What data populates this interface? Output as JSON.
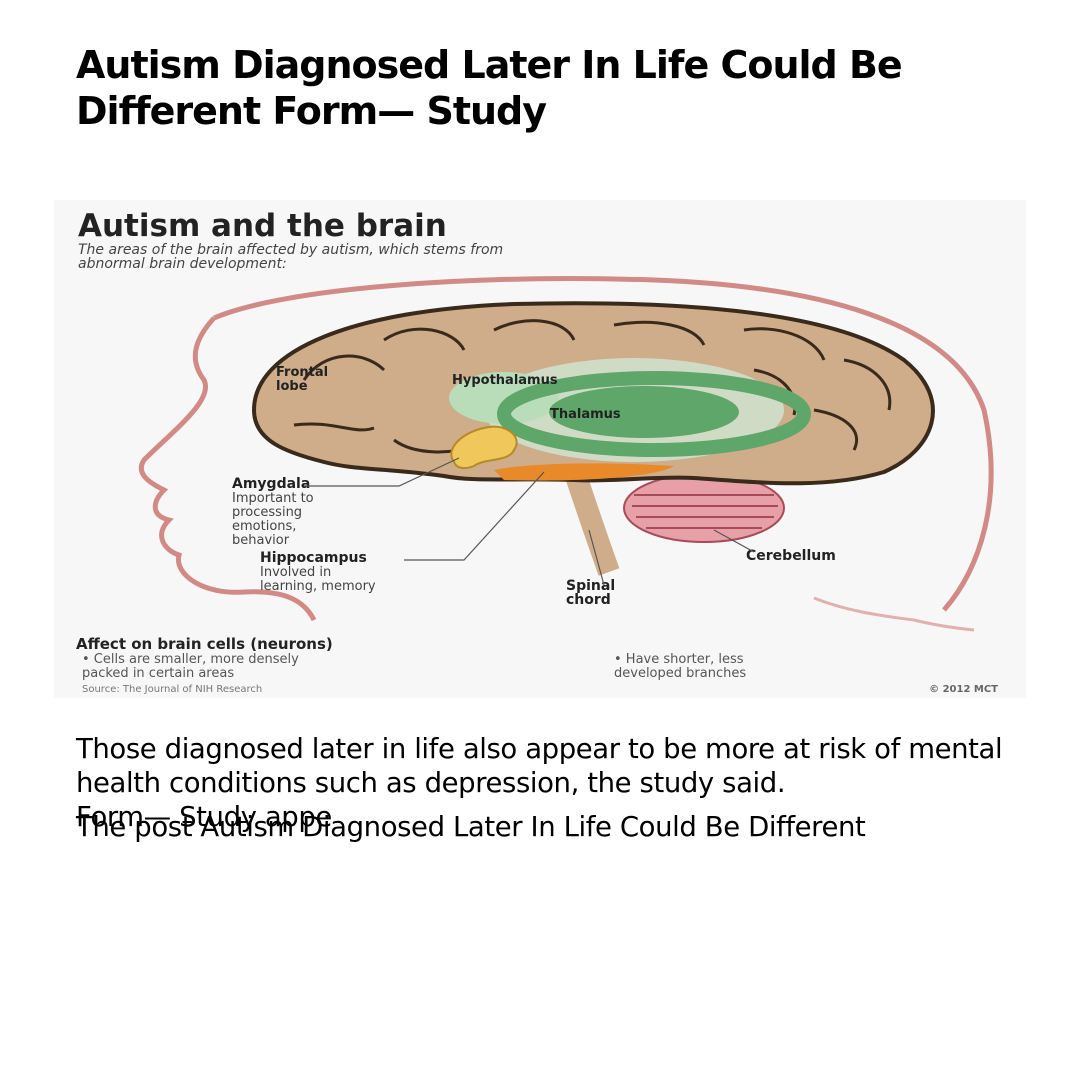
{
  "article": {
    "headline": "Autism Diagnosed Later In Life Could Be Different Form— Study",
    "paragraph": "Those diagnosed later in life also appear to be more at risk of mental health conditions such as depression, the study said.",
    "overlap_line_1": "Form— Study appe",
    "overlap_line_2": "The post Autism Diagnosed Later In Life Could Be Different"
  },
  "infographic": {
    "title": "Autism and the brain",
    "subtitle_line_1": "The areas of the brain affected by autism, which stems from",
    "subtitle_line_2": "abnormal brain development:",
    "labels": {
      "frontal_lobe_1": "Frontal",
      "frontal_lobe_2": "lobe",
      "hypothalamus": "Hypothalamus",
      "thalamus": "Thalamus",
      "amygdala": "Amygdala",
      "amygdala_desc_1": "Important to",
      "amygdala_desc_2": "processing",
      "amygdala_desc_3": "emotions,",
      "amygdala_desc_4": "behavior",
      "hippocampus": "Hippocampus",
      "hippocampus_desc_1": "Involved in",
      "hippocampus_desc_2": "learning, memory",
      "spinal_1": "Spinal",
      "spinal_2": "chord",
      "cerebellum": "Cerebellum"
    },
    "effects_heading": "Affect on brain cells (neurons)",
    "effect_1_line_1": "• Cells are smaller, more densely",
    "effect_1_line_2": "packed in certain areas",
    "effect_2_line_1": "• Have shorter, less",
    "effect_2_line_2": "developed branches",
    "source": "Source: The Journal of NIH Research",
    "credit": "© 2012 MCT",
    "colors": {
      "brain": "#cfac8a",
      "brain_outline": "#3a2a1c",
      "head_outline": "#d28a86",
      "limbic_green": "#5fa66a",
      "amygdala_yellow": "#f0c75a",
      "hippocampus_orange": "#e98a2a",
      "cerebellum_pink": "#e8a0a8"
    }
  }
}
